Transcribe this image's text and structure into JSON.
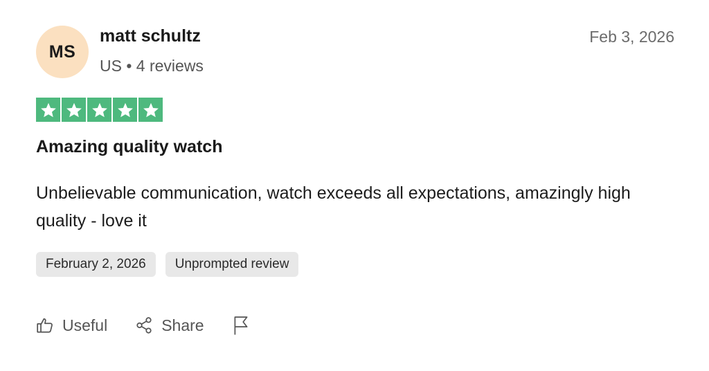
{
  "reviewer": {
    "initials": "MS",
    "name": "matt schultz",
    "meta": "US • 4 reviews"
  },
  "review": {
    "date": "Feb 3, 2026",
    "rating": 5,
    "title": "Amazing quality watch",
    "body": "Unbelievable communication, watch exceeds all expectations, amazingly high quality - love it"
  },
  "tags": [
    {
      "label": "February 2, 2026"
    },
    {
      "label": "Unprompted review"
    }
  ],
  "actions": {
    "useful_label": "Useful",
    "share_label": "Share"
  },
  "colors": {
    "star_green": "#4eb97e",
    "avatar_bg": "#fbe0c0",
    "tag_bg": "#e8e8e8",
    "muted_text": "#555555"
  },
  "icons": {
    "useful": "thumbs-up-icon",
    "share": "share-icon",
    "flag": "flag-icon",
    "star": "star-icon"
  }
}
